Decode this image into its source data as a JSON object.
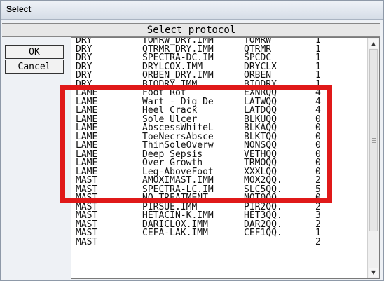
{
  "window": {
    "title": "Select"
  },
  "panel": {
    "header": "Select protocol"
  },
  "buttons": {
    "ok": "OK",
    "cancel": "Cancel"
  },
  "list": {
    "rows": [
      [
        "DRY",
        "TOMRW_DRY.IMM",
        "TOMRW",
        "1"
      ],
      [
        "DRY",
        "QTRMR_DRY.IMM",
        "QTRMR",
        "1"
      ],
      [
        "DRY",
        "SPECTRA-DC.IM",
        "SPCDC",
        "1"
      ],
      [
        "DRY",
        "DRYLCOX.IMM",
        "DRYCLX",
        "1"
      ],
      [
        "DRY",
        "ORBEN_DRY.IMM",
        "ORBEN",
        "1"
      ],
      [
        "DRY",
        "BIODRY.IMM",
        "BIODRY",
        "1"
      ],
      [
        "LAME",
        "Foot Rot",
        "EXNRQQ",
        "4"
      ],
      [
        "LAME",
        "Wart - Dig De",
        "LATWQQ",
        "4"
      ],
      [
        "LAME",
        "Heel Crack",
        "LATDQQ",
        "4"
      ],
      [
        "LAME",
        "Sole Ulcer",
        "BLKUQQ",
        "0"
      ],
      [
        "LAME",
        "AbscessWhiteL",
        "BLKAQQ",
        "0"
      ],
      [
        "LAME",
        "ToeNecrsAbsce",
        "BLKTQQ",
        "0"
      ],
      [
        "LAME",
        "ThinSoleOverw",
        "NONSQQ",
        "0"
      ],
      [
        "LAME",
        "Deep Sepsis",
        "VETHQQ",
        "0"
      ],
      [
        "LAME",
        "Over Growth",
        "TRMOQQ",
        "0"
      ],
      [
        "LAME",
        "Leg-AboveFoot",
        "XXXLQQ",
        "0"
      ],
      [
        "MAST",
        "AMOXIMAST.IMM",
        "MOX2QQ.",
        "2"
      ],
      [
        "MAST",
        "SPECTRA-LC.IM",
        "SLC5QQ.",
        "5"
      ],
      [
        "MAST",
        "NO TREATMENT",
        "NOT0QQ.",
        "0"
      ],
      [
        "MAST",
        "PIRSUE.IMM",
        "PIR2QQ.",
        "2"
      ],
      [
        "MAST",
        "HETACIN-K.IMM",
        "HET3QQ.",
        "3"
      ],
      [
        "MAST",
        "DARICLOX.IMM",
        "DAR2QQ.",
        "2"
      ],
      [
        "MAST",
        "CEFA-LAK.IMM",
        "CEF1QQ.",
        "1"
      ],
      [
        "MAST",
        "",
        "",
        "2"
      ]
    ]
  },
  "scrollbar": {
    "up_icon": "▲",
    "down_icon": "▼"
  },
  "colors": {
    "highlight": "#e01919"
  }
}
